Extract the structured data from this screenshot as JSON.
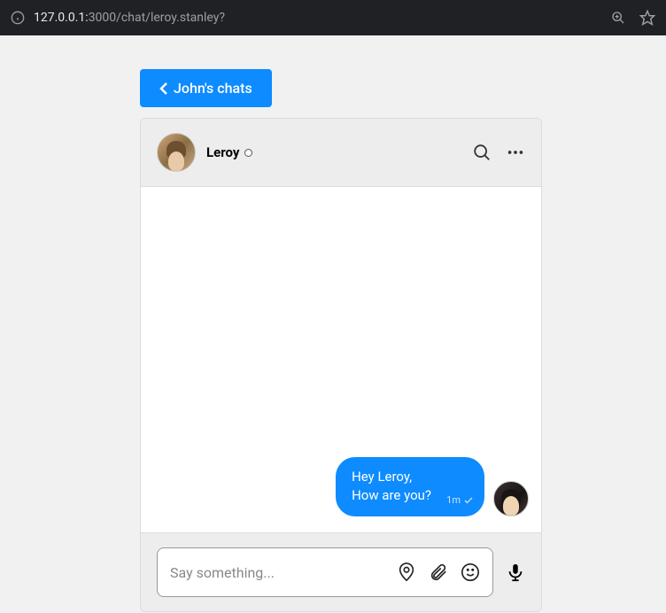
{
  "url": {
    "host": "127.0.0.1:",
    "rest": "3000/chat/leroy.stanley?"
  },
  "back_button": {
    "label": "John's chats"
  },
  "chat": {
    "contact_name": "Leroy",
    "messages": [
      {
        "line1": "Hey Leroy,",
        "line2": "How are you?",
        "time": "1m"
      }
    ],
    "input": {
      "placeholder": "Say something..."
    }
  }
}
